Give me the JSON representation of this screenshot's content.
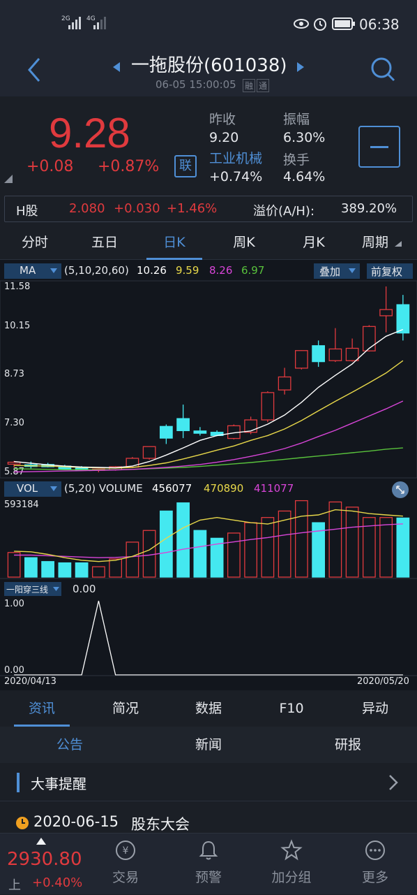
{
  "status_bar": {
    "net1": "2G",
    "net2": "4G",
    "time": "06:38"
  },
  "header": {
    "title": "一拖股份(601038)",
    "timestamp": "06-05 15:00:05",
    "badge1": "融",
    "badge2": "通"
  },
  "quote": {
    "price": "9.28",
    "change": "+0.08",
    "change_pct": "+0.87%",
    "link_badge": "联",
    "prev_close_label": "昨收",
    "prev_close": "9.20",
    "amplitude_label": "振幅",
    "amplitude": "6.30%",
    "industry_label": "工业机械",
    "industry_change": "+0.74%",
    "turnover_label": "换手",
    "turnover": "4.64%"
  },
  "h_share": {
    "label": "H股",
    "price": "2.080",
    "change": "+0.030",
    "change_pct": "+1.46%",
    "premium_label": "溢价(A/H):",
    "premium": "389.20%"
  },
  "period_tabs": [
    "分时",
    "五日",
    "日K",
    "周K",
    "月K",
    "周期"
  ],
  "ma_bar": {
    "label": "MA",
    "params": "(5,10,20,60)",
    "v1": "10.26",
    "v2": "9.59",
    "v3": "8.26",
    "v4": "6.97",
    "overlay": "叠加",
    "adjust": "前复权"
  },
  "price_axis": [
    "11.58",
    "10.15",
    "8.73",
    "7.30",
    "5.87"
  ],
  "vol_bar": {
    "label": "VOL",
    "params": "(5,20) VOLUME",
    "v1": "456077",
    "v2": "470890",
    "v3": "411077",
    "max": "593184"
  },
  "indicator": {
    "label": "一阳穿三线",
    "value": "0.00",
    "top": "1.00",
    "bottom": "0.00"
  },
  "date_axis": {
    "start": "2020/04/13",
    "end": "2020/05/20"
  },
  "info_tabs": [
    "资讯",
    "简况",
    "数据",
    "F10",
    "异动"
  ],
  "sub_tabs": [
    "公告",
    "新闻",
    "研报"
  ],
  "events": {
    "title": "大事提醒",
    "date": "2020-06-15",
    "item": "股东大会"
  },
  "index": {
    "value": "2930.80",
    "market": "上",
    "change_pct": "+0.40%"
  },
  "bottom_nav": [
    "交易",
    "预警",
    "加分组",
    "更多"
  ],
  "colors": {
    "up": "#e03a3e",
    "down": "#44e8f0",
    "accent": "#4f8fd6",
    "ma5": "#ffffff",
    "ma10": "#e8d84a",
    "ma20": "#d845d8",
    "ma60": "#59c23c"
  },
  "chart_data": {
    "type": "candlestick",
    "ylim": [
      5.87,
      11.58
    ],
    "candles": [
      {
        "o": 6.12,
        "h": 6.22,
        "l": 6.02,
        "c": 6.18
      },
      {
        "o": 6.1,
        "h": 6.2,
        "l": 5.99,
        "c": 6.05
      },
      {
        "o": 6.11,
        "h": 6.16,
        "l": 6.02,
        "c": 6.04
      },
      {
        "o": 6.06,
        "h": 6.1,
        "l": 5.96,
        "c": 5.97
      },
      {
        "o": 6.0,
        "h": 6.06,
        "l": 5.92,
        "c": 5.93
      },
      {
        "o": 5.93,
        "h": 5.98,
        "l": 5.87,
        "c": 5.97
      },
      {
        "o": 5.95,
        "h": 6.06,
        "l": 5.92,
        "c": 6.04
      },
      {
        "o": 6.03,
        "h": 6.34,
        "l": 6.0,
        "c": 6.3
      },
      {
        "o": 6.3,
        "h": 6.67,
        "l": 6.26,
        "c": 6.66
      },
      {
        "o": 7.28,
        "h": 7.34,
        "l": 6.74,
        "c": 6.92
      },
      {
        "o": 7.52,
        "h": 7.95,
        "l": 6.92,
        "c": 7.15
      },
      {
        "o": 7.14,
        "h": 7.26,
        "l": 7.0,
        "c": 7.07
      },
      {
        "o": 7.1,
        "h": 7.16,
        "l": 6.98,
        "c": 7.0
      },
      {
        "o": 6.91,
        "h": 7.34,
        "l": 6.88,
        "c": 7.3
      },
      {
        "o": 7.1,
        "h": 7.58,
        "l": 7.04,
        "c": 7.48
      },
      {
        "o": 7.48,
        "h": 8.36,
        "l": 7.41,
        "c": 8.32
      },
      {
        "o": 8.4,
        "h": 9.08,
        "l": 8.26,
        "c": 8.8
      },
      {
        "o": 9.07,
        "h": 9.62,
        "l": 9.03,
        "c": 9.61
      },
      {
        "o": 9.76,
        "h": 9.92,
        "l": 9.11,
        "c": 9.27
      },
      {
        "o": 9.3,
        "h": 10.3,
        "l": 9.26,
        "c": 9.66
      },
      {
        "o": 9.3,
        "h": 9.98,
        "l": 9.27,
        "c": 9.68
      },
      {
        "o": 9.6,
        "h": 10.39,
        "l": 9.58,
        "c": 10.35
      },
      {
        "o": 10.68,
        "h": 11.58,
        "l": 10.17,
        "c": 10.87
      },
      {
        "o": 11.02,
        "h": 11.32,
        "l": 9.92,
        "c": 10.15
      }
    ],
    "ma5": [
      6.2,
      6.15,
      6.1,
      6.06,
      6.03,
      6.02,
      6.01,
      6.06,
      6.2,
      6.4,
      6.62,
      6.85,
      7.0,
      7.08,
      7.14,
      7.35,
      7.63,
      8.02,
      8.48,
      8.85,
      9.2,
      9.68,
      10.05,
      10.26
    ],
    "ma10": [
      6.08,
      6.07,
      6.06,
      6.04,
      6.02,
      6.01,
      6.0,
      6.02,
      6.08,
      6.16,
      6.28,
      6.41,
      6.55,
      6.68,
      6.85,
      7.0,
      7.2,
      7.46,
      7.76,
      8.05,
      8.33,
      8.62,
      8.92,
      9.3
    ],
    "ma20": [
      5.88,
      5.89,
      5.9,
      5.91,
      5.92,
      5.93,
      5.94,
      5.96,
      5.99,
      6.02,
      6.06,
      6.11,
      6.18,
      6.26,
      6.36,
      6.47,
      6.6,
      6.77,
      6.97,
      7.16,
      7.38,
      7.6,
      7.82,
      8.06
    ],
    "ma60": [
      5.98,
      5.97,
      5.96,
      5.95,
      5.95,
      5.95,
      5.95,
      5.96,
      5.98,
      6.0,
      6.02,
      6.05,
      6.09,
      6.13,
      6.17,
      6.22,
      6.27,
      6.32,
      6.37,
      6.42,
      6.47,
      6.52,
      6.58,
      6.62
    ],
    "volume": {
      "ylim": [
        0,
        593184
      ],
      "bars": [
        190000,
        150000,
        120000,
        110000,
        110000,
        80000,
        140000,
        270000,
        360000,
        510000,
        573000,
        360000,
        300000,
        340000,
        420000,
        460000,
        510000,
        590000,
        420000,
        580000,
        540000,
        460000,
        460000,
        456077
      ],
      "ma5": [
        200000,
        195000,
        175000,
        150000,
        130000,
        120000,
        130000,
        160000,
        210000,
        300000,
        380000,
        440000,
        460000,
        440000,
        420000,
        410000,
        440000,
        470000,
        480000,
        520000,
        510000,
        490000,
        480000,
        470890
      ],
      "ma20": [
        170000,
        170000,
        165000,
        160000,
        155000,
        150000,
        152000,
        158000,
        170000,
        190000,
        215000,
        235000,
        255000,
        272000,
        290000,
        305000,
        325000,
        342000,
        356000,
        370000,
        385000,
        395000,
        404000,
        411077
      ]
    },
    "indicator_signal": [
      0,
      0,
      0,
      0,
      0,
      1,
      0,
      0,
      0,
      0,
      0,
      0,
      0,
      0,
      0,
      0,
      0,
      0,
      0,
      0,
      0,
      0,
      0,
      0
    ],
    "x_range": [
      "2020/04/13",
      "2020/05/20"
    ]
  }
}
